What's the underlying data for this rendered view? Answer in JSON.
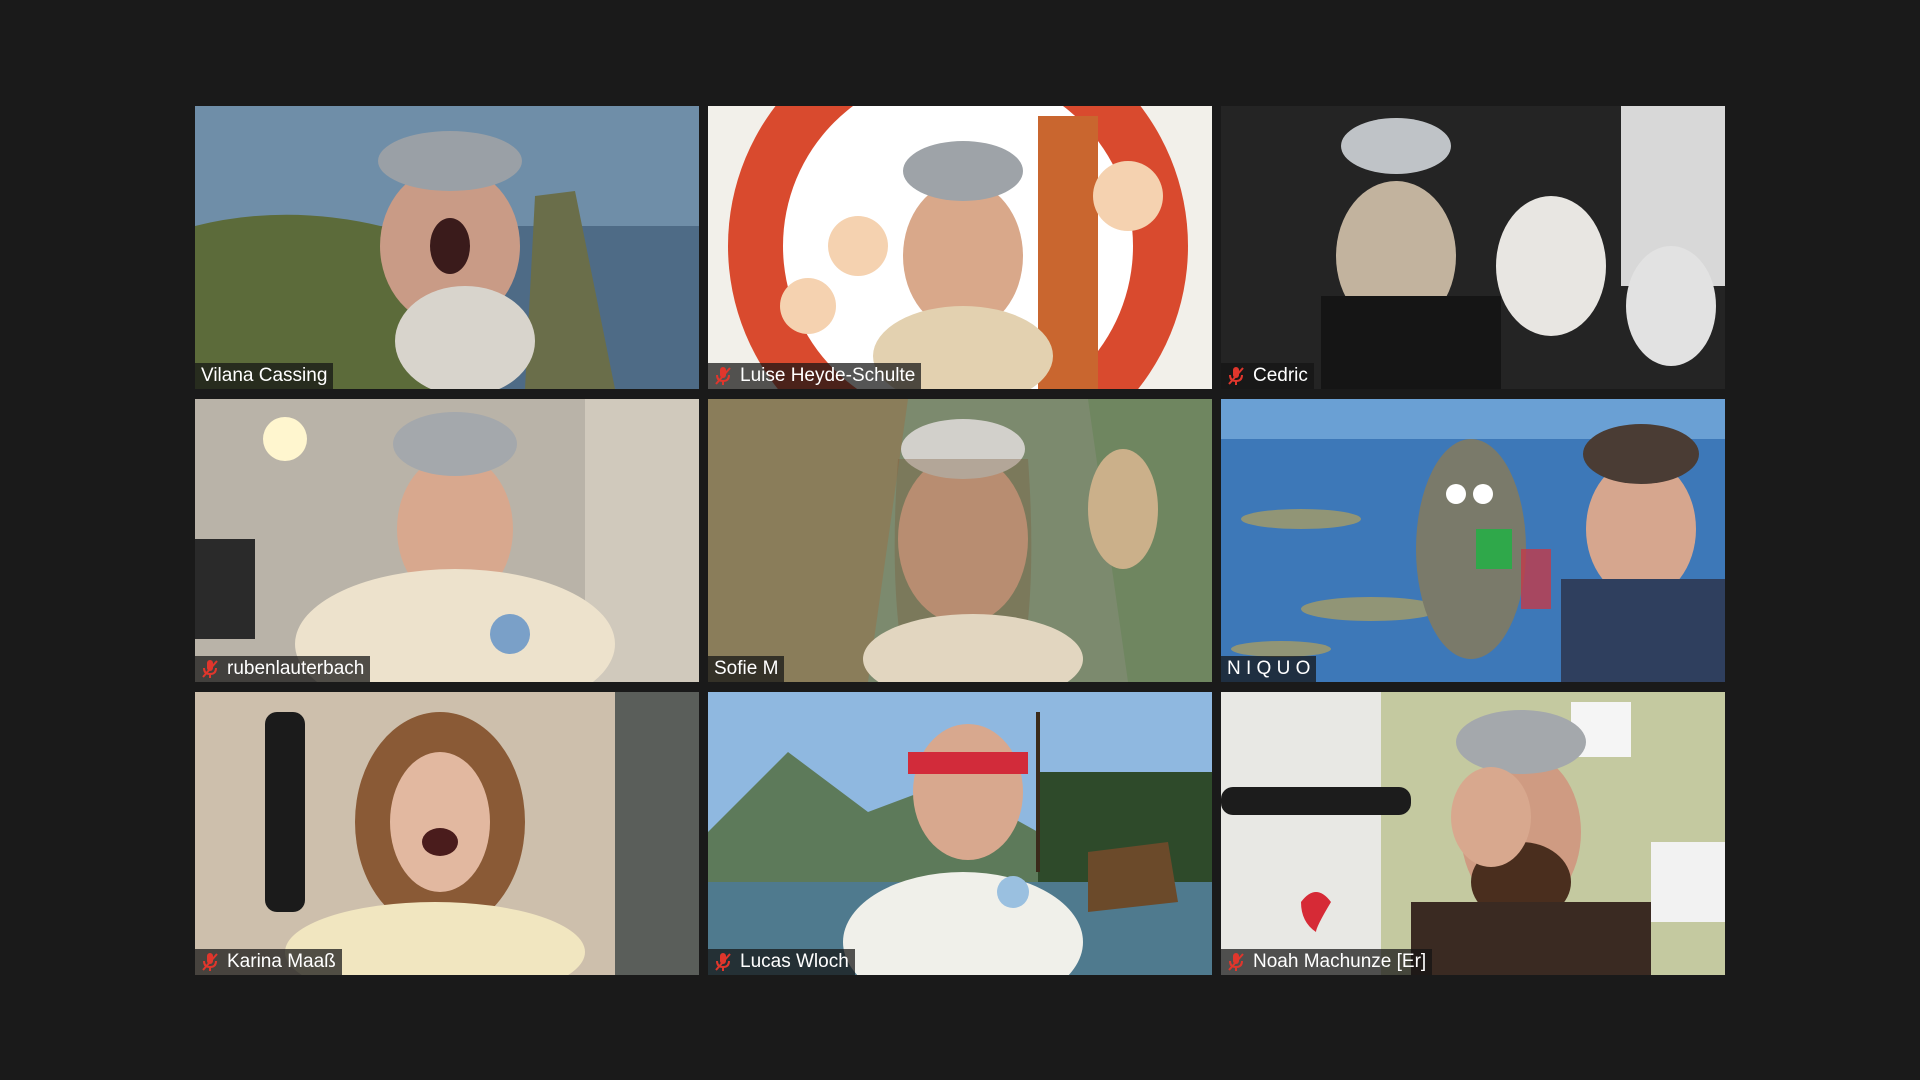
{
  "meeting": {
    "view": "gallery",
    "participants": [
      {
        "name": "Vilana Cassing",
        "muted": false,
        "scene": "cliff-sea"
      },
      {
        "name": "Luise Heyde-Schulte",
        "muted": true,
        "scene": "cartoon-vikings"
      },
      {
        "name": "Cedric",
        "muted": true,
        "scene": "dark-room"
      },
      {
        "name": "rubenlauterbach",
        "muted": true,
        "scene": "bedroom"
      },
      {
        "name": "Sofie M",
        "muted": false,
        "scene": "mountain-forest"
      },
      {
        "name": "N I Q U O",
        "muted": false,
        "scene": "sea-seal"
      },
      {
        "name": "Karina Maaß",
        "muted": true,
        "scene": "kitchen"
      },
      {
        "name": "Lucas Wloch",
        "muted": true,
        "scene": "lake-viking-ship"
      },
      {
        "name": "Noah Machunze [Er]",
        "muted": true,
        "scene": "green-room"
      }
    ]
  },
  "colors": {
    "background": "#1a1a1a",
    "nameplate_bg": "#141414",
    "nameplate_text": "#ffffff",
    "muted_icon": "#e0362c"
  }
}
